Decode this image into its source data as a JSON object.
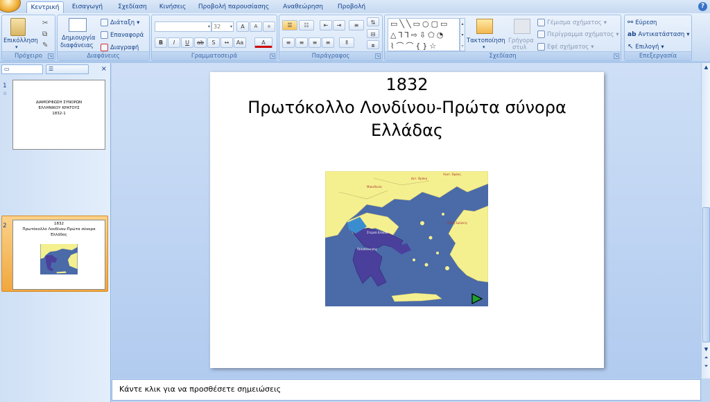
{
  "ribbon_tabs": [
    "Κεντρική",
    "Εισαγωγή",
    "Σχεδίαση",
    "Κινήσεις",
    "Προβολή παρουσίασης",
    "Αναθεώρηση",
    "Προβολή"
  ],
  "groups": {
    "clipboard": {
      "label": "Πρόχειρο",
      "paste": "Επικόλληση"
    },
    "slides": {
      "label": "Διαφάνειες",
      "new_slide_line1": "Δημιουργία",
      "new_slide_line2": "διαφάνειας",
      "layout": "Διάταξη",
      "reset": "Επαναφορά",
      "delete": "Διαγραφή"
    },
    "font": {
      "label": "Γραμματοσειρά",
      "size": "32"
    },
    "paragraph": {
      "label": "Παράγραφος"
    },
    "drawing": {
      "label": "Σχεδίαση",
      "arrange": "Τακτοποίηση",
      "quick_styles_line1": "Γρήγορα",
      "quick_styles_line2": "στυλ",
      "shape_fill": "Γέμισμα σχήματος",
      "shape_outline": "Περίγραμμα σχήματος",
      "shape_effects": "Εφέ σχήματος"
    },
    "editing": {
      "label": "Επεξεργασία",
      "find": "Εύρεση",
      "replace": "Αντικατάσταση",
      "select": "Επιλογή"
    }
  },
  "slides": [
    {
      "number": "1",
      "lines": [
        "ΔΙΑΜΟΡΦΩΣΗ ΣΥΝΟΡΩΝ",
        "ΕΛΛΗΝΙΚΟΥ ΚΡΑΤΟΥΣ",
        "1832-1"
      ]
    },
    {
      "number": "2",
      "lines": [
        "1832",
        "Πρωτόκολλο Λονδίνου-Πρώτα σύνορα",
        "Ελλάδας"
      ]
    }
  ],
  "current_slide": {
    "title_lines": [
      "1832",
      "Πρωτόκολλο Λονδίνου-Πρώτα σύνορα",
      "Ελλάδας"
    ],
    "map_labels": [
      "Μακεδονία",
      "Δυτ. Θράκη",
      "Ανατ. Θράκη",
      "Στερεά Ελλάδα",
      "Πελοπόννησος",
      "Ζώνη Σμύρνης"
    ]
  },
  "notes_placeholder": "Κάντε κλικ για να προσθέσετε σημειώσεις",
  "colors": {
    "ribbon": "#cfe0f5",
    "selected_thumb": "#f1a73e",
    "map_sea": "#4a6aa8",
    "map_land": "#f5f08f",
    "greece_1832": "#4b3f9c"
  }
}
